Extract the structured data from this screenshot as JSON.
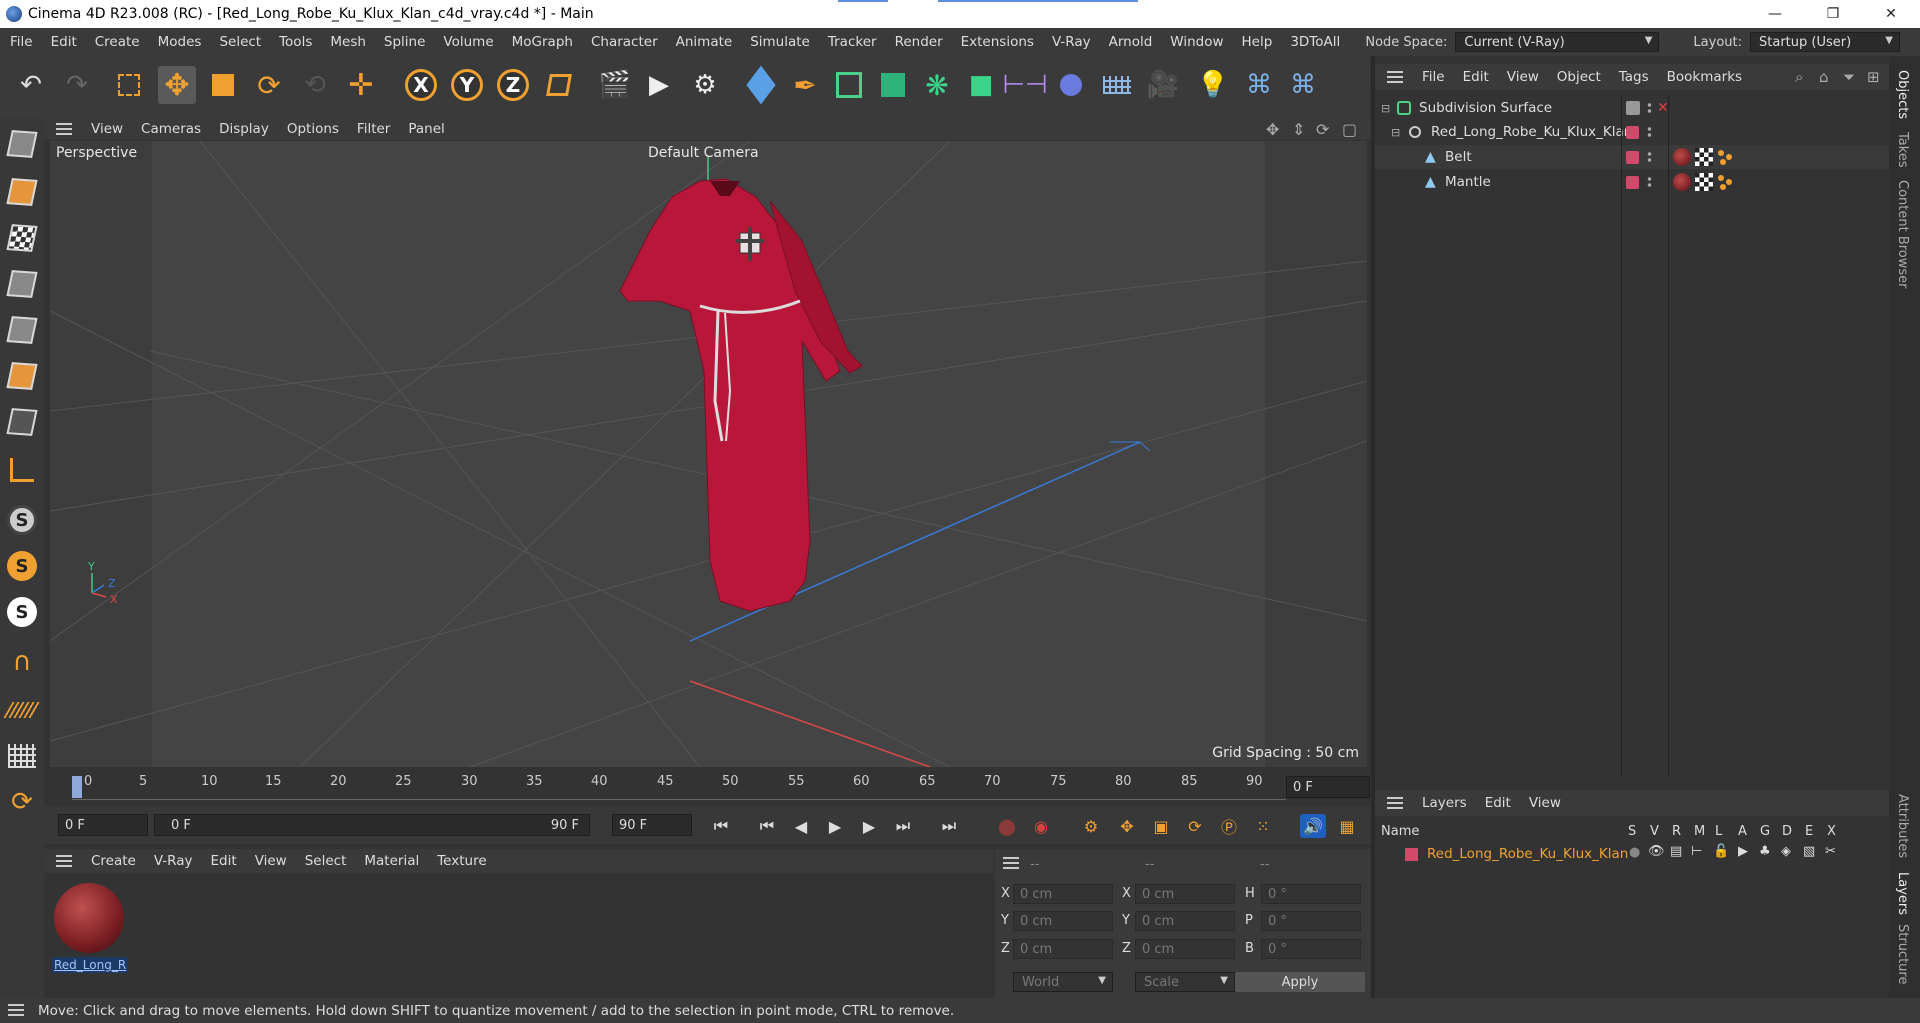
{
  "window": {
    "title": "Cinema 4D R23.008 (RC) - [Red_Long_Robe_Ku_Klux_Klan_c4d_vray.c4d *] - Main",
    "minimize": "—",
    "maximize": "❐",
    "close": "✕"
  },
  "menubar": {
    "items": [
      "File",
      "Edit",
      "Create",
      "Modes",
      "Select",
      "Tools",
      "Mesh",
      "Spline",
      "Volume",
      "MoGraph",
      "Character",
      "Animate",
      "Simulate",
      "Tracker",
      "Render",
      "Extensions",
      "V-Ray",
      "Arnold",
      "Window",
      "Help",
      "3DToAll"
    ],
    "node_space_label": "Node Space:",
    "node_space_value": "Current (V-Ray)",
    "layout_label": "Layout:",
    "layout_value": "Startup (User)"
  },
  "toolbar": {
    "axis_x": "X",
    "axis_y": "Y",
    "axis_z": "Z"
  },
  "viewport": {
    "menu": [
      "View",
      "Cameras",
      "Display",
      "Options",
      "Filter",
      "Panel"
    ],
    "label": "Perspective",
    "camera": "Default Camera",
    "grid_spacing": "Grid Spacing : 50 cm",
    "axis_y": "Y",
    "axis_z": "Z",
    "axis_x": "X"
  },
  "timeline": {
    "ticks": [
      "0",
      "5",
      "10",
      "15",
      "20",
      "25",
      "30",
      "35",
      "40",
      "45",
      "50",
      "55",
      "60",
      "65",
      "70",
      "75",
      "80",
      "85",
      "90"
    ],
    "current_frame": "0 F"
  },
  "transport": {
    "start_field": "0 F",
    "range_start": "0 F",
    "range_end": "90 F",
    "end_field": "90 F"
  },
  "materials": {
    "menu": [
      "Create",
      "V-Ray",
      "Edit",
      "View",
      "Select",
      "Material",
      "Texture"
    ],
    "items": [
      {
        "name": "Red_Long_R"
      }
    ]
  },
  "coordinates": {
    "header": [
      "--",
      "--",
      "--"
    ],
    "rows": [
      {
        "a": "X",
        "av": "0 cm",
        "b": "X",
        "bv": "0 cm",
        "c": "H",
        "cv": "0 °"
      },
      {
        "a": "Y",
        "av": "0 cm",
        "b": "Y",
        "bv": "0 cm",
        "c": "P",
        "cv": "0 °"
      },
      {
        "a": "Z",
        "av": "0 cm",
        "b": "Z",
        "bv": "0 cm",
        "c": "B",
        "cv": "0 °"
      }
    ],
    "space": "World",
    "mode": "Scale",
    "apply": "Apply"
  },
  "objects": {
    "menu": [
      "File",
      "Edit",
      "View",
      "Object",
      "Tags",
      "Bookmarks"
    ],
    "rows": [
      {
        "name": "Subdivision Surface"
      },
      {
        "name": "Red_Long_Robe_Ku_Klux_Klan"
      },
      {
        "name": "Belt"
      },
      {
        "name": "Mantle"
      }
    ]
  },
  "layers": {
    "menu": [
      "Layers",
      "Edit",
      "View"
    ],
    "columns": {
      "name": "Name",
      "flags": [
        "S",
        "V",
        "R",
        "M",
        "L",
        "A",
        "G",
        "D",
        "E",
        "X"
      ]
    },
    "rows": [
      {
        "name": "Red_Long_Robe_Ku_Klux_Klan"
      }
    ]
  },
  "side_tabs": [
    "Objects",
    "Takes",
    "Content Browser",
    "Attributes",
    "Layers",
    "Structure"
  ],
  "status": "Move: Click and drag to move elements. Hold down SHIFT to quantize movement / add to the selection in point mode, CTRL to remove.",
  "colors": {
    "accent": "#f0a030",
    "robe": "#b8173a",
    "layer_name": "#f0a030"
  }
}
